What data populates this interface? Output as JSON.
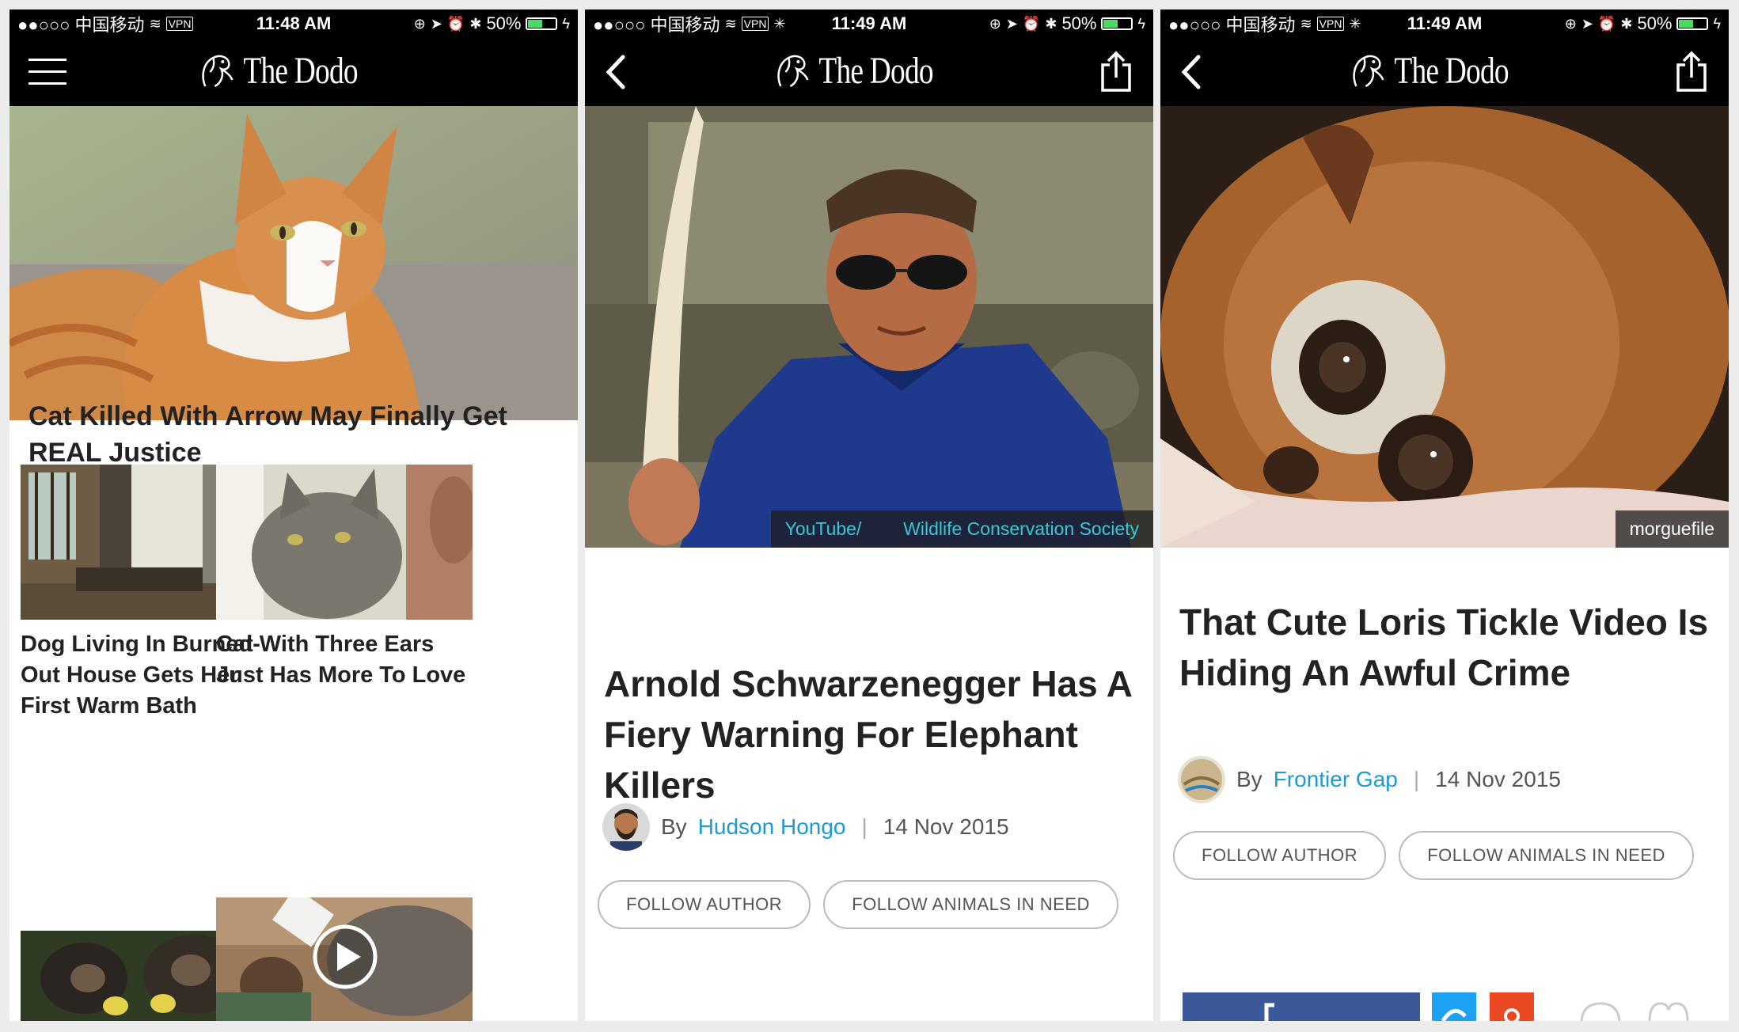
{
  "status_bars": [
    {
      "carrier": "●●○○○ 中国移动",
      "vpn": "VPN",
      "time": "11:48 AM",
      "battery": "50%"
    },
    {
      "carrier": "●●○○○ 中国移动",
      "vpn": "VPN",
      "time": "11:49 AM",
      "battery": "50%"
    },
    {
      "carrier": "●●○○○ 中国移动",
      "vpn": "VPN",
      "time": "11:49 AM",
      "battery": "50%"
    }
  ],
  "brand": {
    "name": "The Dodo"
  },
  "screen1": {
    "lead_title": "Cat Killed With Arrow May Finally Get REAL Justice",
    "cards": [
      {
        "title": "Dog Living In Burned-Out House Gets Her First Warm Bath"
      },
      {
        "title": "Cat With Three Ears Just Has More To Love"
      }
    ]
  },
  "screen2": {
    "credit_source": "YouTube/",
    "credit_owner": "Wildlife Conservation Society",
    "title": "Arnold Schwarzenegger Has A Fiery Warning For Elephant Killers",
    "by": "By",
    "author": "Hudson Hongo",
    "date": "14 Nov 2015",
    "follow_author": "FOLLOW AUTHOR",
    "follow_topic": "FOLLOW ANIMALS IN NEED"
  },
  "screen3": {
    "credit": "morguefile",
    "title": "That Cute Loris Tickle Video Is Hiding An Awful Crime",
    "by": "By",
    "author": "Frontier Gap",
    "date": "14 Nov 2015",
    "follow_author": "FOLLOW AUTHOR",
    "follow_topic": "FOLLOW ANIMALS IN NEED"
  },
  "colors": {
    "author_link": "#1d9bd1",
    "credit_link": "#39c6d6",
    "bar": "#000000",
    "facebook": "#3b5998",
    "twitter": "#1da1f2",
    "stumble": "#eb4924"
  }
}
